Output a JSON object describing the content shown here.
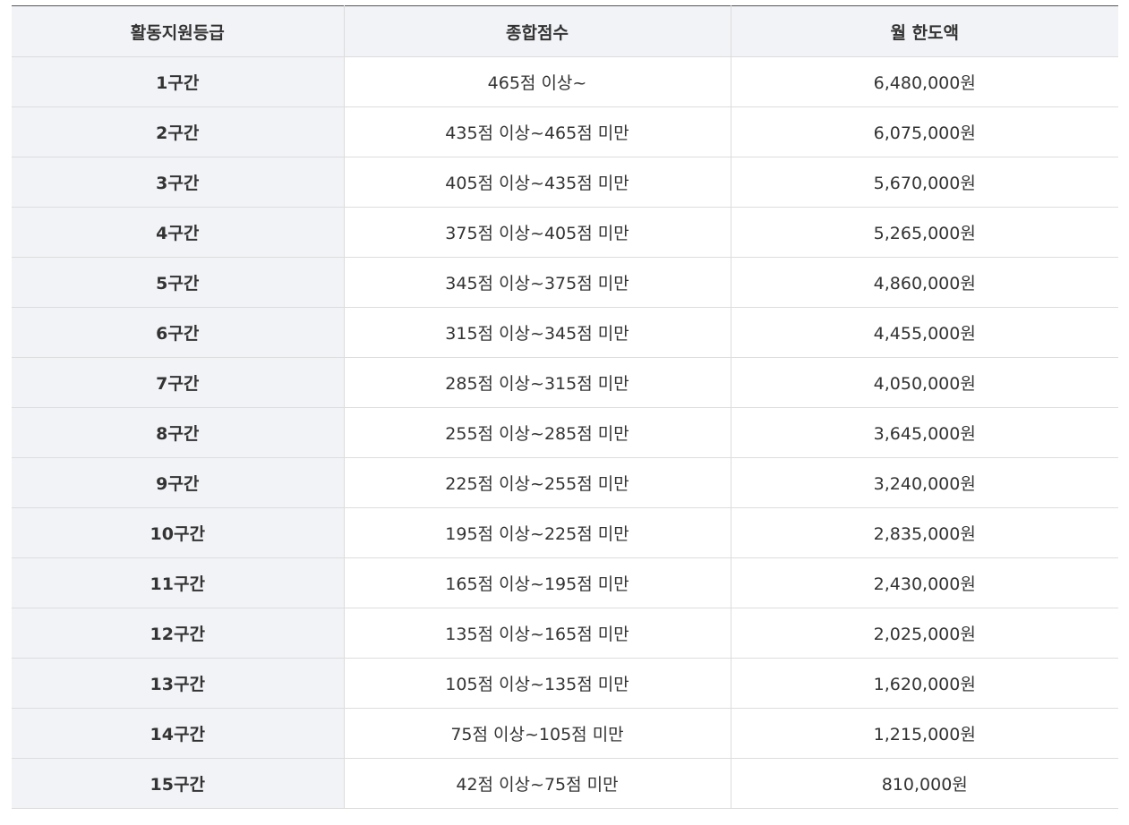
{
  "table": {
    "headers": [
      "활동지원등급",
      "종합점수",
      "월 한도액"
    ],
    "rows": [
      {
        "grade": "1구간",
        "score": "465점 이상~",
        "limit": "6,480,000원"
      },
      {
        "grade": "2구간",
        "score": "435점 이상~465점 미만",
        "limit": "6,075,000원"
      },
      {
        "grade": "3구간",
        "score": "405점 이상~435점 미만",
        "limit": "5,670,000원"
      },
      {
        "grade": "4구간",
        "score": "375점 이상~405점 미만",
        "limit": "5,265,000원"
      },
      {
        "grade": "5구간",
        "score": "345점 이상~375점 미만",
        "limit": "4,860,000원"
      },
      {
        "grade": "6구간",
        "score": "315점 이상~345점 미만",
        "limit": "4,455,000원"
      },
      {
        "grade": "7구간",
        "score": "285점 이상~315점 미만",
        "limit": "4,050,000원"
      },
      {
        "grade": "8구간",
        "score": "255점 이상~285점 미만",
        "limit": "3,645,000원"
      },
      {
        "grade": "9구간",
        "score": "225점 이상~255점 미만",
        "limit": "3,240,000원"
      },
      {
        "grade": "10구간",
        "score": "195점 이상~225점 미만",
        "limit": "2,835,000원"
      },
      {
        "grade": "11구간",
        "score": "165점 이상~195점 미만",
        "limit": "2,430,000원"
      },
      {
        "grade": "12구간",
        "score": "135점 이상~165점 미만",
        "limit": "2,025,000원"
      },
      {
        "grade": "13구간",
        "score": "105점 이상~135점 미만",
        "limit": "1,620,000원"
      },
      {
        "grade": "14구간",
        "score": "75점 이상~105점 미만",
        "limit": "1,215,000원"
      },
      {
        "grade": "15구간",
        "score": "42점 이상~75점 미만",
        "limit": "810,000원"
      }
    ]
  }
}
